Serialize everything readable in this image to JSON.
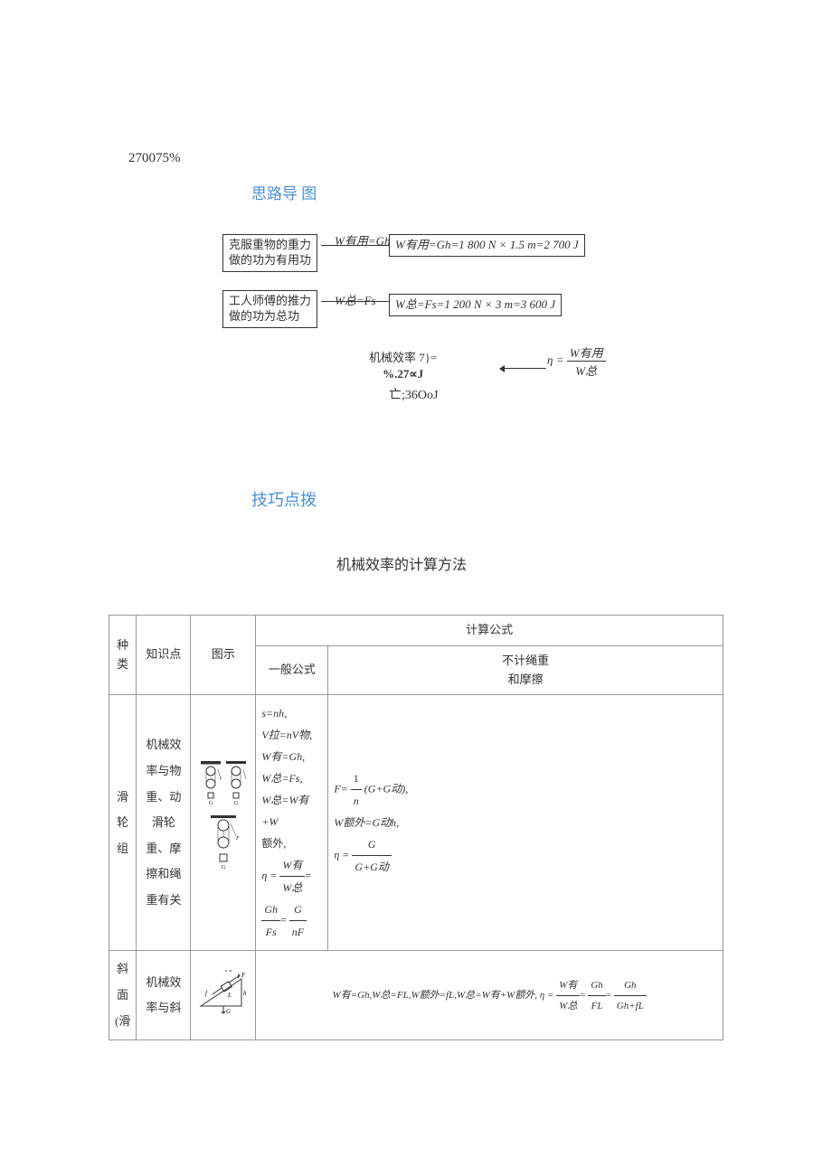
{
  "top_answer": "270075%",
  "heading_flow": "思路导\n图",
  "flow": {
    "box1": "克服重物的重力\n做的功为有用功",
    "label1": "W有用=Gh",
    "box2": "W有用=Gh=1 800 N × 1.5 m=2 700 J",
    "box3": "工人师傅的推力\n做的功为总功",
    "label2": "W总=Fs",
    "box4": "W总=Fs=1 200 N × 3 m=3 600 J",
    "eff_label": "机械效率 7}=",
    "eff_sub": "%.27∝J",
    "eff_frac_label": "η =",
    "eff_frac_num": "W有用",
    "eff_frac_den": "W总",
    "bracket_text": ";36OoJ"
  },
  "heading_tips": "技巧点拨",
  "heading_method": "机械效率的计算方法",
  "table": {
    "header": {
      "c1": "种类",
      "c2": "知识点",
      "c3": "图示",
      "c4": "计算公式",
      "c5": "一般公式",
      "c6": "不计绳重\n和摩擦"
    },
    "row1": {
      "type": "滑\n轮\n组",
      "point": "机械效\n率与物\n重、动\n滑轮\n重、摩\n擦和绳\n重有关",
      "formulas_gen": [
        "s=nh,",
        "V拉=nV物,",
        "W有=Gh,",
        "W总=Fs,",
        "W总=W有+W",
        "额外,"
      ],
      "eta_gen_num": "W有",
      "eta_gen_den": "W总",
      "gh_num": "Gh",
      "gh_den": "Fs",
      "g_num": "G",
      "g_den": "nF",
      "formulas_nofric_f": "(G+G动),",
      "formulas_nofric_w": "W额外=G动h,",
      "eta2_num": "G",
      "eta2_den": "G+G动"
    },
    "row2": {
      "type": "斜面\n(滑",
      "point": "机械效\n率与斜",
      "formula_text": "W有=Gh,W总=FL,W额外=fL,W总=W有+W额外, η =",
      "f1_num": "W有",
      "f1_den": "W总",
      "f2_num": "Gh",
      "f2_den": "FL",
      "f3_num": "Gh",
      "f3_den": "Gh+fL"
    }
  }
}
